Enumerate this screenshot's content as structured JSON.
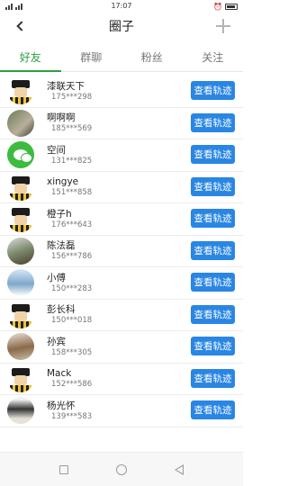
{
  "status_bar": {
    "carrier_text": "46 46",
    "time": "17:07",
    "icons": [
      "signal-icon",
      "wifi-icon",
      "alarm-icon",
      "battery-icon"
    ]
  },
  "header": {
    "title": "圈子",
    "back_icon": "chevron-left-icon",
    "add_icon": "plus-icon"
  },
  "tabs": [
    {
      "label": "好友",
      "active": true
    },
    {
      "label": "群聊",
      "active": false
    },
    {
      "label": "粉丝",
      "active": false
    },
    {
      "label": "关注",
      "active": false
    }
  ],
  "friends": [
    {
      "name": "漆联天下",
      "phone": "175***298",
      "avatar": "default-avatar"
    },
    {
      "name": "啊啊啊",
      "phone": "185***569",
      "avatar": "photo-avatar"
    },
    {
      "name": "空间",
      "phone": "131***825",
      "avatar": "wechat-avatar"
    },
    {
      "name": "xingye",
      "phone": "151***858",
      "avatar": "default-avatar"
    },
    {
      "name": "橙子h",
      "phone": "176***643",
      "avatar": "default-avatar"
    },
    {
      "name": "陈法磊",
      "phone": "156***786",
      "avatar": "photo-avatar"
    },
    {
      "name": "小傅",
      "phone": "150***283",
      "avatar": "photo-avatar"
    },
    {
      "name": "彭长科",
      "phone": "150***018",
      "avatar": "default-avatar"
    },
    {
      "name": "孙宾",
      "phone": "158***305",
      "avatar": "photo-avatar"
    },
    {
      "name": "Mack",
      "phone": "152***586",
      "avatar": "default-avatar"
    },
    {
      "name": "杨光怀",
      "phone": "139***583",
      "avatar": "photo-avatar"
    }
  ],
  "track_button_label": "查看轨迹",
  "colors": {
    "accent_green": "#2aa042",
    "button_blue": "#2a86e3"
  },
  "nav_bar": {
    "icons": [
      "recent-apps-icon",
      "home-icon",
      "back-icon"
    ]
  }
}
